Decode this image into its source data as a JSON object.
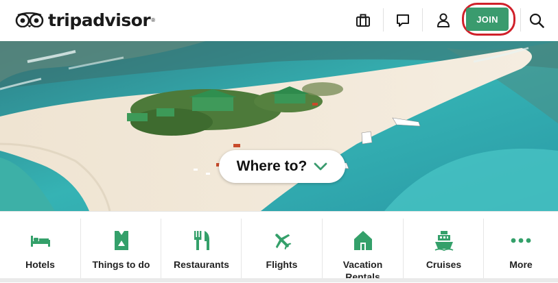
{
  "header": {
    "logo_text": "tripadvisor",
    "logo_reg": "®",
    "icons": [
      "trips-icon",
      "messages-icon",
      "profile-icon",
      "search-icon"
    ],
    "join_label": "JOIN"
  },
  "hero": {
    "search_label": "Where to?",
    "search_icon": "chevron-down-icon"
  },
  "categories": [
    {
      "label": "Hotels",
      "icon": "bed-icon"
    },
    {
      "label": "Things to do",
      "icon": "ticket-icon"
    },
    {
      "label": "Restaurants",
      "icon": "fork-knife-icon"
    },
    {
      "label": "Flights",
      "icon": "airplane-icon"
    },
    {
      "label": "Vacation Rentals",
      "icon": "house-icon"
    },
    {
      "label": "Cruises",
      "icon": "ship-icon"
    },
    {
      "label": "More",
      "icon": "more-dots-icon"
    }
  ],
  "colors": {
    "brand_green": "#3a9b6e",
    "icon_green": "#34a06a",
    "highlight_ring": "#d0202a"
  }
}
